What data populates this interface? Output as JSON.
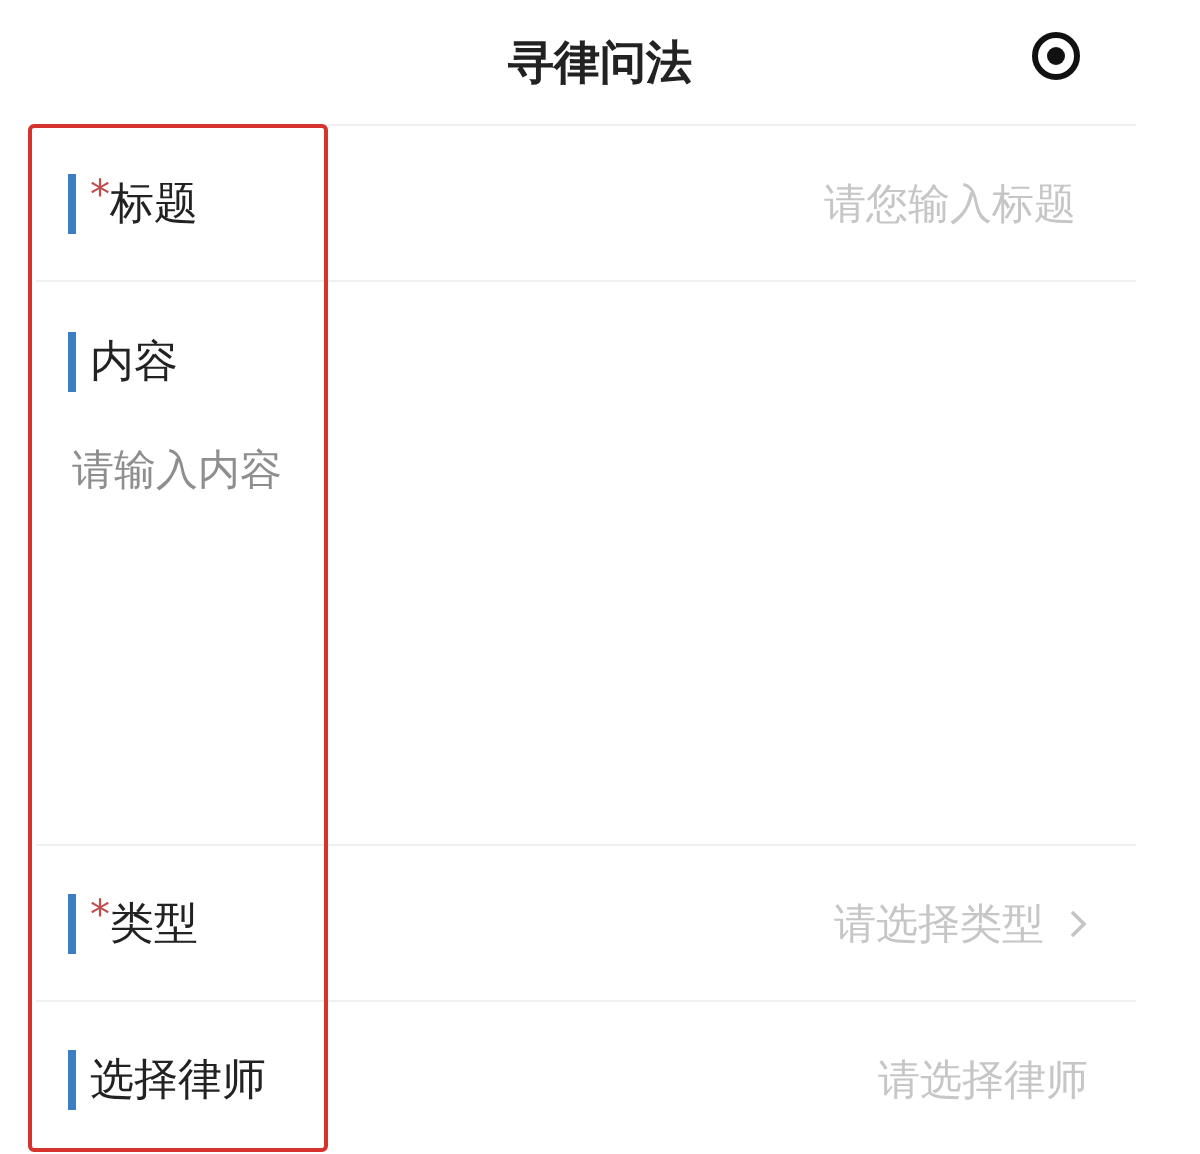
{
  "header": {
    "title": "寻律问法"
  },
  "fields": [
    {
      "kind": "input",
      "label": "标题",
      "required_mark": "*",
      "placeholder": "请您输入标题"
    },
    {
      "kind": "textarea",
      "label": "内容",
      "placeholder": "请输入内容"
    },
    {
      "kind": "select",
      "label": "类型",
      "required_mark": "*",
      "placeholder": "请选择类型",
      "chevron": true
    },
    {
      "kind": "select",
      "label": "选择律师",
      "placeholder": "请选择律师",
      "chevron": false
    }
  ],
  "annotation": {
    "kind": "highlight-frame"
  }
}
